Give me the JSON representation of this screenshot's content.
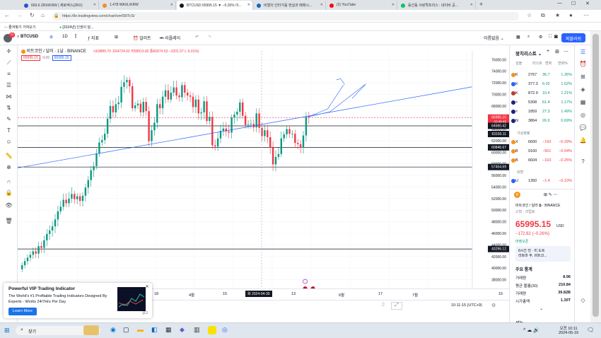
{
  "browser": {
    "tabs": [
      {
        "label": "669.6 ZRX/KRW | 제로엑스(ZRX)"
      },
      {
        "label": "1.478 WAXL/KRW"
      },
      {
        "label": "BTCUSD 65995.15 ▼ −0.26% 이..."
      },
      {
        "label": "비열의 인터가음 현실과 매매시..."
      },
      {
        "label": "(2) YouTube"
      },
      {
        "label": "동선동 사랑퀵프리스 : 네이버 공..."
      }
    ],
    "url": "https://kr.tradingview.com/chart/smf30TcS/",
    "bookmarks": [
      "즐겨찾기 가져오기",
      "[2024년] 인생이 달..."
    ]
  },
  "header": {
    "symbol": "BTCUSD",
    "interval": "1D",
    "indicators_label": "지표",
    "alert_label": "얼러트",
    "replay_label": "리플레이",
    "layout_name": "이름없음",
    "publish_label": "퍼블리쉬",
    "avatar_badge": "11"
  },
  "legend": {
    "title": "비트코인 / 달러 · 1날 · BINANCE",
    "ohlc": "시63889.70  고64724.63  저58913.82  종60674.53  −3201.57 (−5.01%)",
    "price_badge": "65995.15",
    "zero_badge": "0.00",
    "price_badge2": "65995.15"
  },
  "chart_data": {
    "type": "candlestick",
    "y_ticks": [
      "76000.00",
      "74000.00",
      "72000.00",
      "70000.00",
      "68000.00",
      "66000.00",
      "64000.00",
      "62000.00",
      "60000.00",
      "58000.00",
      "56000.00",
      "54000.00",
      "52000.00",
      "50000.00",
      "48000.00",
      "46000.00",
      "44000.00",
      "42000.00",
      "40000.00",
      "38000.00",
      "36000.00"
    ],
    "ylim": [
      35500,
      77500
    ],
    "x_ticks": [
      "18",
      "4월",
      "15",
      "13",
      "6월",
      "17",
      "7월",
      "15"
    ],
    "x_label_highlight": "화 2024-04-30",
    "price_tags": [
      {
        "text": "65995.15",
        "sub": "22:48:45",
        "value": 65995.15,
        "color": "#f23645"
      },
      {
        "text": "64560.42",
        "value": 64560.42,
        "color": "#131722"
      },
      {
        "text": "63150.11",
        "value": 63150.11,
        "color": "#131722"
      },
      {
        "text": "60846.67",
        "value": 60846.67,
        "color": "#131722"
      },
      {
        "text": "57454.69",
        "value": 57454.69,
        "color": "#131722"
      },
      {
        "text": "43296.12",
        "value": 43296.12,
        "color": "#131722"
      }
    ],
    "horizontal_lines": [
      64560.42,
      60846.67,
      57454.69,
      43296.12
    ],
    "closes": [
      40500,
      41200,
      41800,
      42300,
      42900,
      42500,
      43800,
      43500,
      44800,
      45900,
      46500,
      47200,
      48400,
      49800,
      50600,
      51800,
      51200,
      52000,
      52800,
      51900,
      52400,
      51600,
      52500,
      53900,
      55200,
      56900,
      57600,
      59800,
      61700,
      62100,
      63200,
      65800,
      68000,
      66900,
      68300,
      68600,
      71300,
      72100,
      72500,
      71400,
      67600,
      68100,
      68400,
      66900,
      68700,
      67100,
      61900,
      63800,
      65100,
      68300,
      67600,
      69600,
      70700,
      69100,
      70300,
      71200,
      69800,
      69500,
      71600,
      70300,
      69800,
      69600,
      67800,
      69100,
      66700,
      66900,
      68800,
      65400,
      66100,
      61200,
      61000,
      62400,
      63700,
      64100,
      63600,
      63400,
      66000,
      66500,
      67000,
      68600,
      66300,
      64700,
      64800,
      64900,
      64300,
      66700,
      64200,
      62800,
      63800,
      62600,
      60800,
      57900,
      59200,
      59700,
      62400,
      63100,
      64000,
      63200,
      63200,
      61600,
      61400,
      60800,
      62900,
      66100,
      65996
    ],
    "trend_line": {
      "from": [
        "2024-01-10",
        57300
      ],
      "to": [
        "2024-06-30",
        71300
      ]
    }
  },
  "time_bar": {
    "clock": "10:11:15 (UTC+9)"
  },
  "watchlist": {
    "title": "왓치리스트",
    "columns": [
      "심볼",
      "라스트",
      "변화",
      "변화%"
    ],
    "rows": [
      {
        "sym": "K",
        "last": "2767",
        "chg": "36.7",
        "pct": "1.35%",
        "dir": "up",
        "color": "#f7931a"
      },
      {
        "sym": "K",
        "last": "377.3",
        "chg": "6.02",
        "pct": "1.62%",
        "dir": "up",
        "color": "#2962ff"
      },
      {
        "sym": "K",
        "last": "872.9",
        "chg": "10.4",
        "pct": "1.21%",
        "dir": "up",
        "color": "#c0392b"
      },
      {
        "sym": "×",
        "last": "5308",
        "chg": "61.4",
        "pct": "1.17%",
        "dir": "up",
        "color": "#1a237e"
      },
      {
        "sym": "×",
        "last": "1859",
        "chg": "27.3",
        "pct": "1.49%",
        "dir": "up",
        "color": "#1a237e"
      },
      {
        "sym": "N",
        "last": "3864",
        "chg": "26.6",
        "pct": "0.69%",
        "dir": "up",
        "color": "#1a237e"
      }
    ],
    "section_fx": "가상화폐",
    "fx_rows": [
      {
        "sym": "X",
        "last": "6600",
        "chg": "−193",
        "pct": "−0.29%",
        "dir": "down",
        "color": "#f7931a"
      },
      {
        "sym": "B",
        "last": "9160",
        "chg": "−501",
        "pct": "−0.54%",
        "dir": "down",
        "color": "#f7931a"
      },
      {
        "sym": "B",
        "last": "6604",
        "chg": "−163",
        "pct": "−0.25%",
        "dir": "down",
        "color": "#f7931a"
      }
    ],
    "section_fut": "외환",
    "fut_rows": [
      {
        "sym": "U",
        "last": "1350",
        "chg": "−1.4",
        "pct": "−0.10%",
        "dir": "down",
        "color": "#2962ff"
      }
    ]
  },
  "details": {
    "sym": "B",
    "name": "비트코인 / 달러",
    "exchange": "BINANCE",
    "category": "스팟 · 크립토",
    "price": "65995.15",
    "currency": "USD",
    "change": "−172.82 (−0.26%)",
    "status": "마켓오픈",
    "news_1": "8시간 전 · 미 도트",
    "news_2": "라토마 주, 비트코...",
    "stats_title": "주요 통계",
    "stats": [
      {
        "label": "거래량",
        "value": "8.96"
      },
      {
        "label": "평균 볼륨(30)",
        "value": "210.84"
      },
      {
        "label": "거래량",
        "value": "39.82B"
      },
      {
        "label": "시가총액",
        "value": "1.30T"
      }
    ],
    "more": "성능"
  },
  "ad": {
    "title": "Powerful VIP Trading Indicator",
    "body": "The World's #1 Profitable Trading Indicators Designed By Experts - Works 24/7Hrs Per Day",
    "cta": "Learn More",
    "badge": "광고"
  },
  "taskbar": {
    "search": "찾기",
    "time": "오전 10:11",
    "date": "2024-05-16"
  }
}
